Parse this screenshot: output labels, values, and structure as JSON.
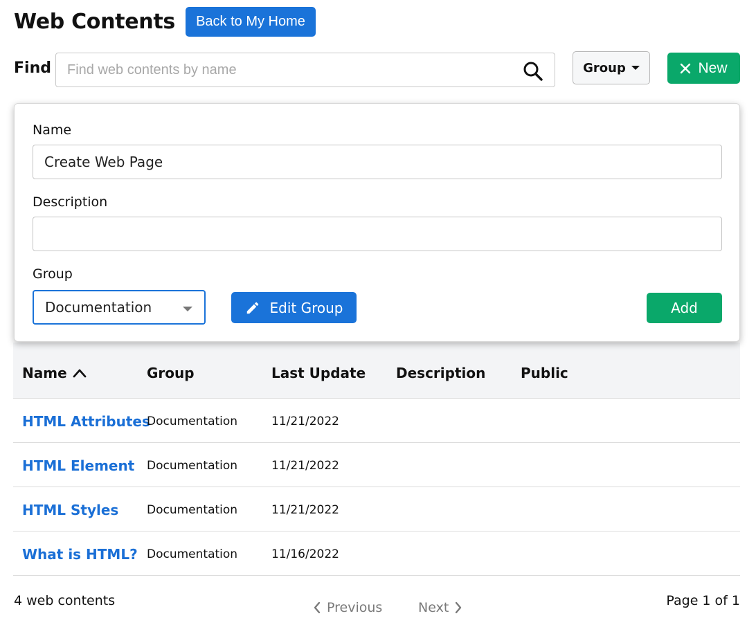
{
  "header": {
    "title": "Web Contents",
    "back_label": "Back to My Home"
  },
  "toolbar": {
    "find_label": "Find",
    "search_placeholder": "Find web contents by name",
    "search_value": "",
    "group_label": "Group",
    "new_label": "New"
  },
  "form": {
    "name_label": "Name",
    "name_value": "Create Web Page",
    "description_label": "Description",
    "description_value": "",
    "group_label": "Group",
    "group_selected": "Documentation",
    "edit_group_label": "Edit Group",
    "add_label": "Add"
  },
  "table": {
    "columns": [
      "Name",
      "Group",
      "Last Update",
      "Description",
      "Public"
    ],
    "sort": {
      "column": "Name",
      "direction": "ascending"
    },
    "rows": [
      {
        "name": "HTML Attributes",
        "group": "Documentation",
        "last_update": "11/21/2022",
        "description": "",
        "public": ""
      },
      {
        "name": "HTML Element",
        "group": "Documentation",
        "last_update": "11/21/2022",
        "description": "",
        "public": ""
      },
      {
        "name": "HTML Styles",
        "group": "Documentation",
        "last_update": "11/21/2022",
        "description": "",
        "public": ""
      },
      {
        "name": "What is HTML?",
        "group": "Documentation",
        "last_update": "11/16/2022",
        "description": "",
        "public": ""
      }
    ]
  },
  "footer": {
    "count_text": "4 web contents",
    "previous_label": "Previous",
    "next_label": "Next",
    "page_text": "Page 1 of 1"
  },
  "colors": {
    "primary_blue": "#1a73d9",
    "success_green": "#0aa86a",
    "link_blue": "#1a6fd6"
  },
  "icons": {
    "search": "search-icon",
    "close": "close-icon",
    "pencil": "pencil-icon",
    "sort_ascending": "chevron-up-icon"
  }
}
